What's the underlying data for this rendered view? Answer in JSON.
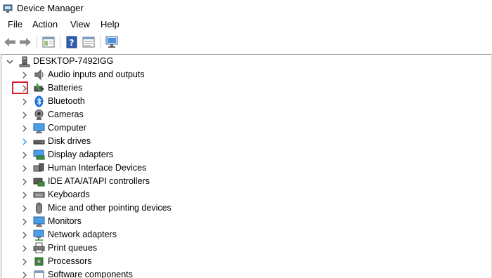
{
  "window": {
    "title": "Device Manager"
  },
  "menu": {
    "items": [
      "File",
      "Action",
      "View",
      "Help"
    ]
  },
  "toolbar": {
    "buttons": [
      "back-icon",
      "forward-icon",
      "properties-sheet-icon",
      "help-icon",
      "update-view-icon",
      "scan-hardware-icon"
    ]
  },
  "tree": {
    "root": {
      "label": "DESKTOP-7492IGG",
      "expanded": true
    },
    "categories": [
      {
        "label": "Audio inputs and outputs",
        "icon": "speaker-icon"
      },
      {
        "label": "Batteries",
        "icon": "battery-icon"
      },
      {
        "label": "Bluetooth",
        "icon": "bluetooth-icon"
      },
      {
        "label": "Cameras",
        "icon": "camera-icon"
      },
      {
        "label": "Computer",
        "icon": "computer-icon"
      },
      {
        "label": "Disk drives",
        "icon": "disk-drive-icon"
      },
      {
        "label": "Display adapters",
        "icon": "display-adapter-icon"
      },
      {
        "label": "Human Interface Devices",
        "icon": "hid-icon"
      },
      {
        "label": "IDE ATA/ATAPI controllers",
        "icon": "ide-controller-icon"
      },
      {
        "label": "Keyboards",
        "icon": "keyboard-icon"
      },
      {
        "label": "Mice and other pointing devices",
        "icon": "mouse-icon"
      },
      {
        "label": "Monitors",
        "icon": "monitor-icon"
      },
      {
        "label": "Network adapters",
        "icon": "network-adapter-icon"
      },
      {
        "label": "Print queues",
        "icon": "printer-icon"
      },
      {
        "label": "Processors",
        "icon": "processor-icon"
      },
      {
        "label": "Software components",
        "icon": "software-component-icon"
      }
    ]
  },
  "colors": {
    "highlight": "#d9232e",
    "expander_hover": "#1e90ff",
    "expander": "#555555"
  }
}
